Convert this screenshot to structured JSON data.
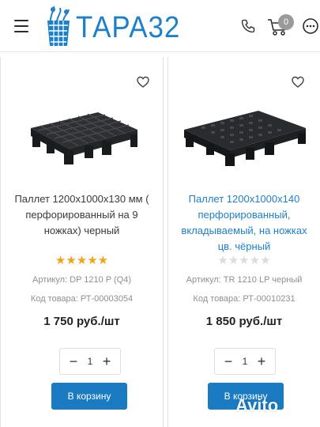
{
  "header": {
    "logo_text": "ТАРА32",
    "cart_count": "0",
    "brand_color": "#1f7fc8"
  },
  "products": [
    {
      "title": "Паллет 1200х1000х130 мм ( перфорированный на 9 ножках) черный",
      "rating": 5,
      "stars": "★★★★★",
      "article": "Артикул: DP 1210 P (Q4)",
      "code": "Код товара: РТ-00003054",
      "price": "1 750 руб./шт",
      "quantity": "1",
      "cart_label": "В корзину"
    },
    {
      "title": "Паллет 1200х1000х140 перфорированный, вкладываемый, на ножках цв. чёрный",
      "rating": 0,
      "stars": "★★★★★",
      "article": "Артикул: TR 1210 LP черный",
      "code": "Код товара: РТ-00010231",
      "price": "1 850 руб./шт",
      "quantity": "1",
      "cart_label": "В корзину"
    }
  ],
  "watermark": "Avito",
  "icons": [
    "menu-icon",
    "phone-icon",
    "cart-icon",
    "more-icon",
    "heart-icon",
    "minus-icon",
    "plus-icon"
  ]
}
